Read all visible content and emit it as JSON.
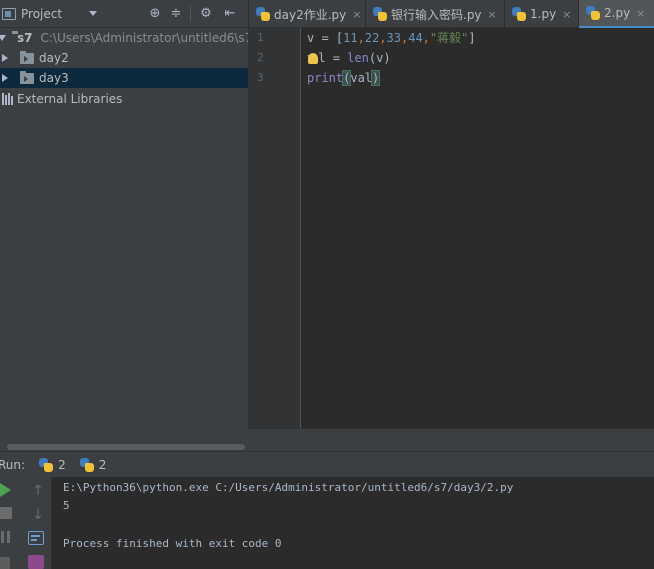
{
  "project_panel": {
    "title": "Project",
    "header_icons": [
      "target-icon",
      "collapse-icon",
      "gear-icon",
      "hide-icon"
    ],
    "tree": {
      "root_name": "s7",
      "root_path": "C:\\Users\\Administrator\\untitled6\\s7",
      "folders": [
        "day2",
        "day3"
      ],
      "selected_folder": "day3",
      "external_libraries": "External Libraries"
    }
  },
  "tabs": [
    {
      "label": "day2作业.py",
      "close": "×",
      "active": false
    },
    {
      "label": "银行输入密码.py",
      "close": "×",
      "active": false
    },
    {
      "label": "1.py",
      "close": "×",
      "active": false
    },
    {
      "label": "2.py",
      "close": "×",
      "active": true
    }
  ],
  "editor": {
    "line_numbers": [
      "1",
      "2",
      "3"
    ],
    "lines": [
      {
        "var": "v",
        "assign": " = ",
        "open": "[",
        "nums": [
          "11",
          "22",
          "33",
          "44"
        ],
        "comma": ",",
        "str": "\"蒋毅\"",
        "close": "]"
      },
      {
        "var_start": "v",
        "var_end": "l",
        "assign": " = ",
        "func": "len",
        "open": "(",
        "arg": "v",
        "close": ")"
      },
      {
        "func": "print",
        "open": "(",
        "arg": "val",
        "close": ")"
      }
    ]
  },
  "run": {
    "label": "Run:",
    "tabs": [
      {
        "label": "2"
      },
      {
        "label": "2"
      }
    ],
    "console": [
      "E:\\Python36\\python.exe C:/Users/Administrator/untitled6/s7/day3/2.py",
      "5",
      "",
      "Process finished with exit code 0"
    ]
  },
  "colors": {
    "background": "#2b2b2b",
    "panel": "#3c3f41",
    "selection": "#0d293e",
    "number": "#6897bb",
    "string": "#6a8759",
    "builtin": "#8888c6",
    "keyword_op": "#cc7832",
    "run_green": "#4ea34e"
  }
}
